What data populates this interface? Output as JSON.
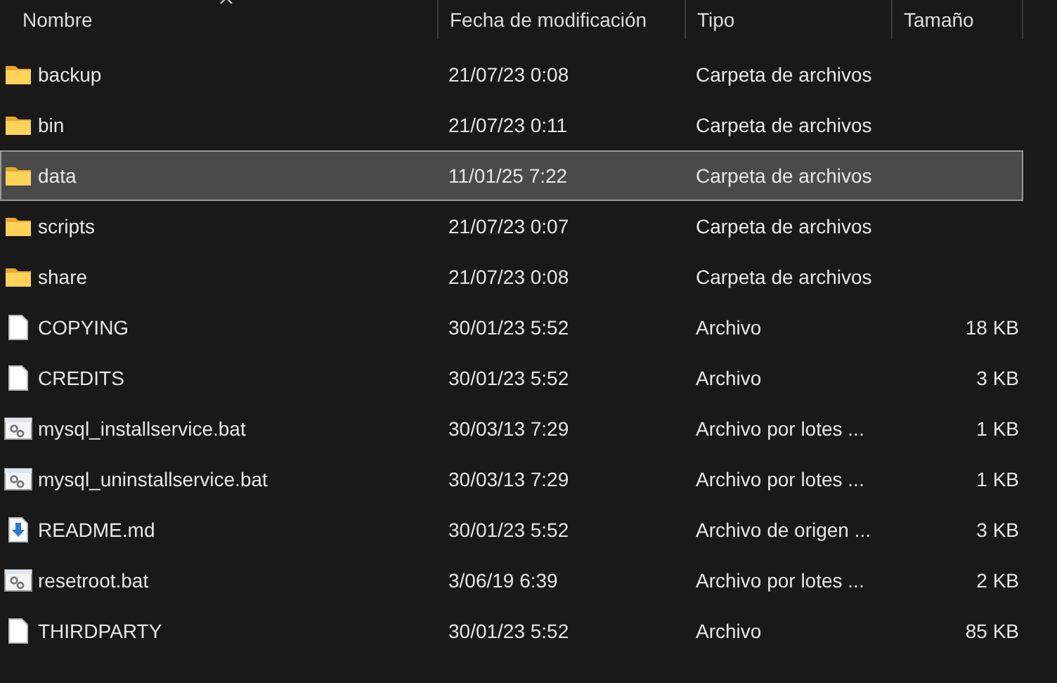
{
  "columns": [
    {
      "label": "Nombre",
      "sorted": true
    },
    {
      "label": "Fecha de modificación",
      "sorted": false
    },
    {
      "label": "Tipo",
      "sorted": false
    },
    {
      "label": "Tamaño",
      "sorted": false
    }
  ],
  "rows": [
    {
      "kind": "folder",
      "name": "backup",
      "date": "21/07/23 0:08",
      "type": "Carpeta de archivos",
      "selected": false
    },
    {
      "kind": "folder",
      "name": "bin",
      "date": "21/07/23 0:11",
      "type": "Carpeta de archivos",
      "selected": false
    },
    {
      "kind": "folder",
      "name": "data",
      "date": "11/01/25 7:22",
      "type": "Carpeta de archivos",
      "selected": true
    },
    {
      "kind": "folder",
      "name": "scripts",
      "date": "21/07/23 0:07",
      "type": "Carpeta de archivos",
      "selected": false
    },
    {
      "kind": "folder",
      "name": "share",
      "date": "21/07/23 0:08",
      "type": "Carpeta de archivos",
      "selected": false
    },
    {
      "kind": "file",
      "name": "COPYING",
      "date": "30/01/23 5:52",
      "type": "Archivo",
      "size": "18 KB",
      "selected": false
    },
    {
      "kind": "file",
      "name": "CREDITS",
      "date": "30/01/23 5:52",
      "type": "Archivo",
      "size": "3 KB",
      "selected": false
    },
    {
      "kind": "batch",
      "name": "mysql_installservice.bat",
      "date": "30/03/13 7:29",
      "type": "Archivo por lotes ...",
      "size": "1 KB",
      "selected": false
    },
    {
      "kind": "batch",
      "name": "mysql_uninstallservice.bat",
      "date": "30/03/13 7:29",
      "type": "Archivo por lotes ...",
      "size": "1 KB",
      "selected": false
    },
    {
      "kind": "markdown",
      "name": "README.md",
      "date": "30/01/23 5:52",
      "type": "Archivo de origen ...",
      "size": "3 KB",
      "selected": false
    },
    {
      "kind": "batch",
      "name": "resetroot.bat",
      "date": "3/06/19 6:39",
      "type": "Archivo por lotes ...",
      "size": "2 KB",
      "selected": false
    },
    {
      "kind": "file",
      "name": "THIRDPARTY",
      "date": "30/01/23 5:52",
      "type": "Archivo",
      "size": "85 KB",
      "selected": false
    }
  ]
}
